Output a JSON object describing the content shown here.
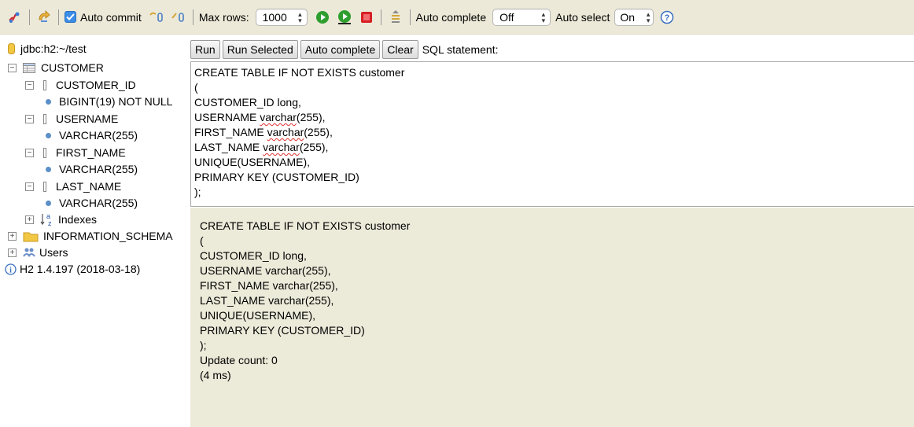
{
  "toolbar": {
    "auto_commit_label": "Auto commit",
    "max_rows_label": "Max rows:",
    "max_rows_value": "1000",
    "auto_complete_label": "Auto complete",
    "auto_complete_value": "Off",
    "auto_select_label": "Auto select",
    "auto_select_value": "On",
    "help_label": "?"
  },
  "sidebar": {
    "connection": "jdbc:h2:~/test",
    "table": "CUSTOMER",
    "columns": [
      {
        "name": "CUSTOMER_ID",
        "type": "BIGINT(19) NOT NULL"
      },
      {
        "name": "USERNAME",
        "type": "VARCHAR(255)"
      },
      {
        "name": "FIRST_NAME",
        "type": "VARCHAR(255)"
      },
      {
        "name": "LAST_NAME",
        "type": "VARCHAR(255)"
      }
    ],
    "indexes": "Indexes",
    "information_schema": "INFORMATION_SCHEMA",
    "users": "Users",
    "version": "H2 1.4.197 (2018-03-18)"
  },
  "buttons": {
    "run": "Run",
    "run_selected": "Run Selected",
    "auto_complete": "Auto complete",
    "clear": "Clear",
    "sql_statement_label": "SQL statement:"
  },
  "editor": {
    "lines": [
      "CREATE TABLE IF NOT EXISTS customer",
      "(",
      "CUSTOMER_ID long,",
      "USERNAME ",
      "FIRST_NAME ",
      "LAST_NAME ",
      "UNIQUE(USERNAME),",
      "PRIMARY KEY (CUSTOMER_ID)",
      ");"
    ],
    "misspelled_word": "varchar",
    "misspelled_suffix": "(255),"
  },
  "result": {
    "lines": [
      "CREATE TABLE IF NOT EXISTS customer",
      "(",
      "CUSTOMER_ID long,",
      "USERNAME varchar(255),",
      "FIRST_NAME varchar(255),",
      "LAST_NAME varchar(255),",
      "UNIQUE(USERNAME),",
      "PRIMARY KEY (CUSTOMER_ID)",
      ");",
      "Update count: 0",
      "(4 ms)"
    ]
  },
  "colors": {
    "toolbar_bg": "#ece9d8",
    "result_bg": "#ecead9",
    "green": "#2e9e2e",
    "red": "#d61f26",
    "blue": "#3b8de6",
    "folder": "#f2c744"
  },
  "icons": [
    "disconnect-icon",
    "refresh-icon",
    "rollback-icon",
    "commit-icon",
    "run-icon",
    "run-selected-icon",
    "stop-icon",
    "history-icon",
    "help-icon",
    "database-icon",
    "table-icon",
    "column-icon",
    "index-icon",
    "folder-icon",
    "users-icon",
    "info-icon"
  ]
}
